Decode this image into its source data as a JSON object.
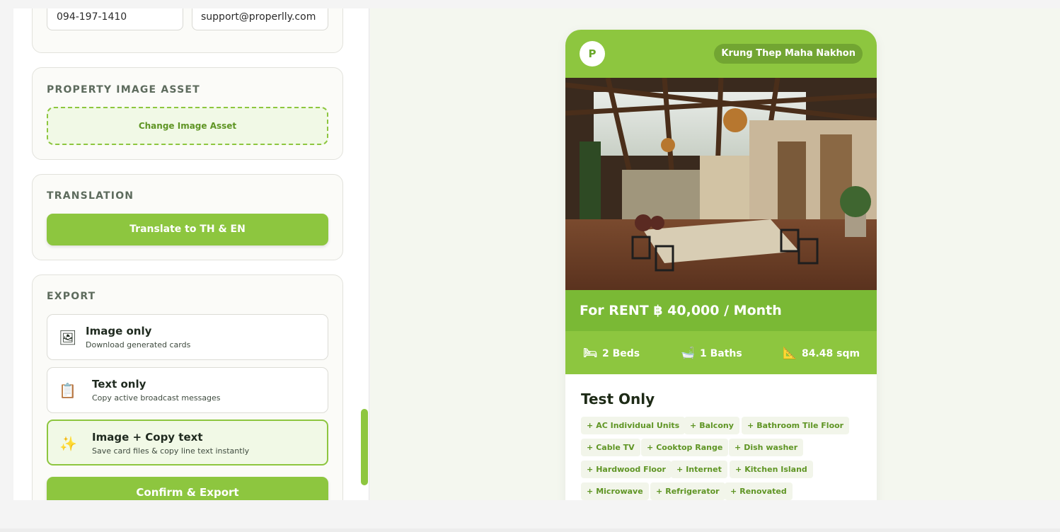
{
  "contact": {
    "phone": "094-197-1410",
    "email": "support@properlly.com"
  },
  "image_section": {
    "title": "PROPERTY IMAGE ASSET",
    "button": "Change Image Asset"
  },
  "translation": {
    "title": "TRANSLATION",
    "button": "Translate to TH & EN"
  },
  "export": {
    "title": "EXPORT",
    "options": [
      {
        "icon": "🖼",
        "icon_name": "framed-picture-icon",
        "title": "Image only",
        "desc": "Download generated cards"
      },
      {
        "icon": "📋",
        "icon_name": "clipboard-icon",
        "title": "Text only",
        "desc": "Copy active broadcast messages"
      },
      {
        "icon": "✨",
        "icon_name": "sparkles-icon",
        "title": "Image + Copy text",
        "desc": "Save card files & copy line text instantly"
      }
    ],
    "selected_index": 2,
    "confirm": "Confirm & Export"
  },
  "preview": {
    "logo": "P",
    "location": "Krung Thep Maha Nakhon",
    "price": "For RENT ฿ 40,000 / Month",
    "stats": {
      "beds": {
        "icon": "🛏",
        "label": "2 Beds"
      },
      "baths": {
        "icon": "🛁",
        "label": "1 Baths"
      },
      "area": {
        "icon": "📐",
        "label": "84.48 sqm"
      }
    },
    "title": "Test Only",
    "tags": [
      "AC Individual Units",
      "Balcony",
      "Bathroom Tile Floor",
      "Cable TV",
      "Cooktop Range",
      "Dish washer",
      "Hardwood Floor",
      "Internet",
      "Kitchen Island",
      "Microwave",
      "Refrigerator",
      "Renovated"
    ]
  },
  "colors": {
    "accent": "#8dc63f",
    "accent_dark": "#7ab935",
    "pill": "#72a532",
    "tag_text": "#5f9524"
  }
}
